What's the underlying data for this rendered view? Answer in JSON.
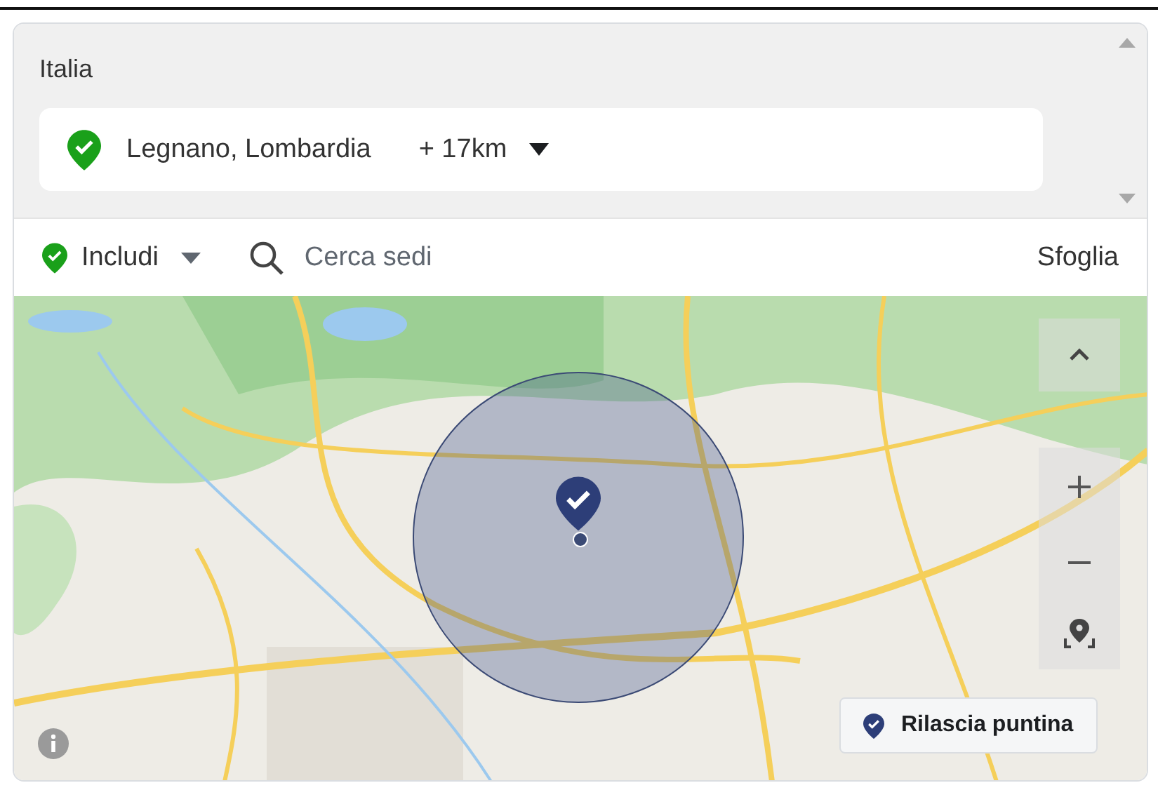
{
  "country": "Italia",
  "location": {
    "name": "Legnano, Lombardia",
    "radius": "+ 17km"
  },
  "mode": {
    "label": "Includi"
  },
  "search": {
    "placeholder": "Cerca sedi"
  },
  "browse": "Sfoglia",
  "map": {
    "kind": "picture",
    "drop_pin": "Rilascia puntina"
  }
}
